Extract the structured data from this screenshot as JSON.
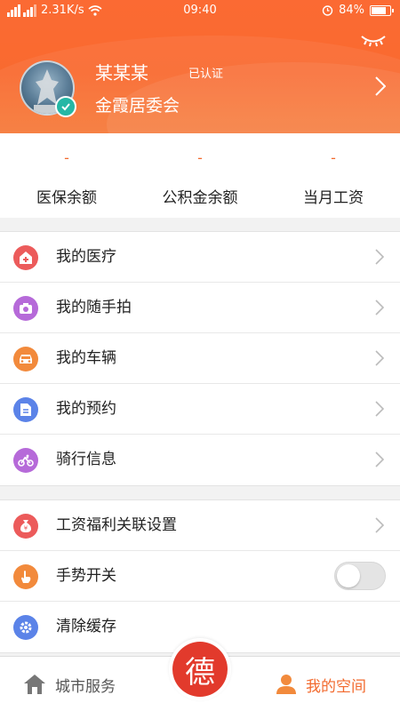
{
  "status_bar": {
    "carrier_signal": "𝄞",
    "network_speed": "2.31K/s",
    "time": "09:40",
    "battery": "84%",
    "battery_fraction": 0.84
  },
  "profile": {
    "name": "某某某",
    "verified_label": "已认证",
    "organization": "金霞居委会"
  },
  "balances": [
    {
      "value": "-",
      "label": "医保余额"
    },
    {
      "value": "-",
      "label": "公积金余额"
    },
    {
      "value": "-",
      "label": "当月工资"
    }
  ],
  "menu_group_1": [
    {
      "label": "我的医疗",
      "icon": "medical-icon",
      "color": "#ec5b5b"
    },
    {
      "label": "我的随手拍",
      "icon": "camera-icon",
      "color": "#b66ad9"
    },
    {
      "label": "我的车辆",
      "icon": "car-icon",
      "color": "#f28a3c"
    },
    {
      "label": "我的预约",
      "icon": "document-icon",
      "color": "#5b83e8"
    },
    {
      "label": "骑行信息",
      "icon": "bike-icon",
      "color": "#b66ad9"
    }
  ],
  "menu_group_2": [
    {
      "label": "工资福利关联设置",
      "icon": "money-bag-icon",
      "color": "#ec5b5b"
    },
    {
      "label": "手势开关",
      "icon": "hand-icon",
      "color": "#f28a3c",
      "toggle": false
    },
    {
      "label": "清除缓存",
      "icon": "gear-icon",
      "color": "#5b83e8"
    }
  ],
  "tabbar": {
    "city_service": "城市服务",
    "center_glyph": "德",
    "my_space": "我的空间"
  },
  "colors": {
    "accent": "#f26a2e",
    "header": "#fb6a33",
    "center_button": "#e23a2c"
  }
}
